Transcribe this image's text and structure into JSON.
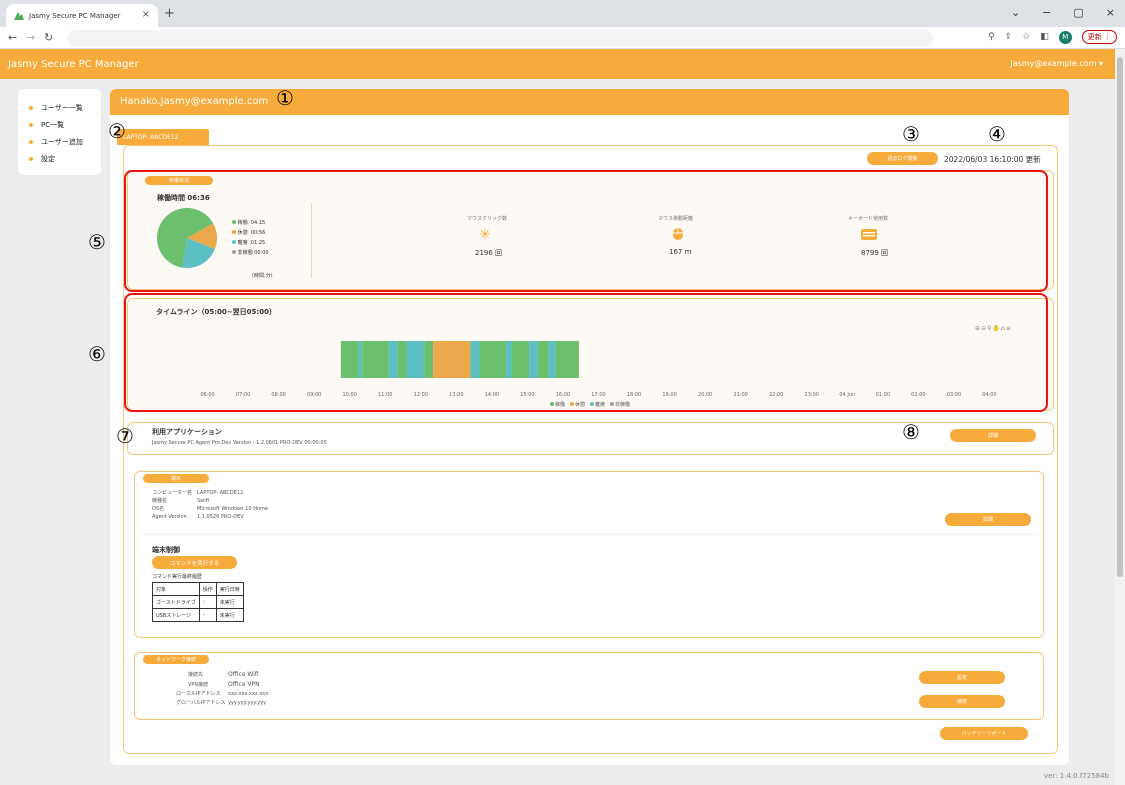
{
  "browser": {
    "tab_title": "Jasmy Secure PC Manager",
    "update_label": "更新",
    "avatar_letter": "M"
  },
  "app": {
    "title": "Jasmy Secure PC Manager",
    "user_menu": "Jasmy@example.com ▾",
    "version": "ver: 1.4.0.f72584b"
  },
  "sidebar": {
    "items": [
      {
        "label": "ユーザー一覧"
      },
      {
        "label": "PC一覧"
      },
      {
        "label": "ユーザー追加"
      },
      {
        "label": "設定"
      }
    ]
  },
  "header": {
    "user_email": "Hanako.Jasmy@example.com"
  },
  "pc": {
    "tab_label": "LAPTOP- ABCDE12",
    "log_button": "過去ログ閲覧",
    "updated": "2022/06/03 16:10:00 更新"
  },
  "status": {
    "label": "稼働状況",
    "operating_time": "稼働時間 06:36",
    "legend": [
      {
        "label": "稼働",
        "value": "04:15",
        "color": "#6cbf6c"
      },
      {
        "label": "休憩",
        "value": "00:56",
        "color": "#eaa84b"
      },
      {
        "label": "離席",
        "value": "01:25",
        "color": "#5bbfc4"
      },
      {
        "label": "非稼働",
        "value": "00:00",
        "color": "#a0a0a0"
      }
    ],
    "unit": "(時間:分)",
    "pie": [
      {
        "label": "稼働",
        "value": 255
      },
      {
        "label": "休憩",
        "value": 56
      },
      {
        "label": "離席",
        "value": 85
      }
    ],
    "metrics": [
      {
        "title": "マウスクリック数",
        "value": "2196 回"
      },
      {
        "title": "マウス移動距離",
        "value": "167 m"
      },
      {
        "title": "キーボード使用数",
        "value": "8799 回"
      }
    ]
  },
  "timeline": {
    "title": "タイムライン（05:00~翌日05:00）",
    "ticks": [
      "06:00",
      "07:00",
      "08:00",
      "09:00",
      "10:00",
      "11:00",
      "12:00",
      "13:00",
      "14:00",
      "15:00",
      "16:00",
      "17:00",
      "18:00",
      "19:00",
      "20:00",
      "21:00",
      "22:00",
      "23:00",
      "04 Jun",
      "01:00",
      "02:00",
      "03:00",
      "04:00"
    ],
    "legend": [
      {
        "label": "稼働",
        "color": "#6cbf6c"
      },
      {
        "label": "休憩",
        "color": "#eaa84b"
      },
      {
        "label": "離席",
        "color": "#5bbfc4"
      },
      {
        "label": "非稼働",
        "color": "#a0a0a0"
      }
    ],
    "segments": [
      {
        "start": 9.75,
        "end": 10.25,
        "state": "稼働"
      },
      {
        "start": 10.25,
        "end": 10.35,
        "state": "離席"
      },
      {
        "start": 10.35,
        "end": 11.1,
        "state": "稼働"
      },
      {
        "start": 11.1,
        "end": 11.35,
        "state": "離席"
      },
      {
        "start": 11.35,
        "end": 11.6,
        "state": "稼働"
      },
      {
        "start": 11.6,
        "end": 12.1,
        "state": "離席"
      },
      {
        "start": 12.1,
        "end": 12.35,
        "state": "稼働"
      },
      {
        "start": 12.35,
        "end": 13.4,
        "state": "休憩"
      },
      {
        "start": 13.4,
        "end": 13.65,
        "state": "離席"
      },
      {
        "start": 13.65,
        "end": 14.4,
        "state": "稼働"
      },
      {
        "start": 14.4,
        "end": 14.55,
        "state": "離席"
      },
      {
        "start": 14.55,
        "end": 15.05,
        "state": "稼働"
      },
      {
        "start": 15.05,
        "end": 15.3,
        "state": "離席"
      },
      {
        "start": 15.3,
        "end": 15.6,
        "state": "稼働"
      },
      {
        "start": 15.6,
        "end": 15.8,
        "state": "離席"
      },
      {
        "start": 15.8,
        "end": 16.45,
        "state": "稼働"
      }
    ]
  },
  "apps": {
    "title": "利用アプリケーション",
    "agent_line": "Jasmy Secure PC Agent Pro Dev Version : 1.2.0601 PRO-DEV 00:00:05",
    "detail_button": "詳細"
  },
  "terminal": {
    "label": "端末",
    "rows": [
      {
        "k": "コンピューター名",
        "v": "LAPTOP- ABCDE12"
      },
      {
        "k": "機種名",
        "v": "Swift"
      },
      {
        "k": "OS名",
        "v": "Microsoft Windows 10 Home"
      },
      {
        "k": "Agent Version",
        "v": "1.1.0526 PRO-DEV"
      }
    ],
    "detail_button": "詳細",
    "control_title": "端末制御",
    "command_button": "コマンドを実行する",
    "history_title": "コマンド実行最終履歴",
    "table": {
      "headers": [
        "対象",
        "操作",
        "実行日時"
      ],
      "rows": [
        [
          "ゴーストドライブ",
          "-",
          "未実行"
        ],
        [
          "USBストレージ",
          "-",
          "未実行"
        ]
      ]
    }
  },
  "network": {
    "label": "ネットワーク接続",
    "rows": [
      {
        "k": "接続先",
        "v": "Office Wifi"
      },
      {
        "k": "VPN接続",
        "v": "Office VPN"
      },
      {
        "k": "ローカルIPアドレス",
        "v": "xxx.xxx.xxx.xxx"
      },
      {
        "k": "グローバルIPアドレス",
        "v": "yyy.yyy.yyy.yyy"
      }
    ],
    "btn1": "設定",
    "btn2": "接続"
  },
  "battery_button": "バッテリーリポート",
  "annotations": [
    "①",
    "②",
    "③",
    "④",
    "⑤",
    "⑥",
    "⑦",
    "⑧"
  ]
}
